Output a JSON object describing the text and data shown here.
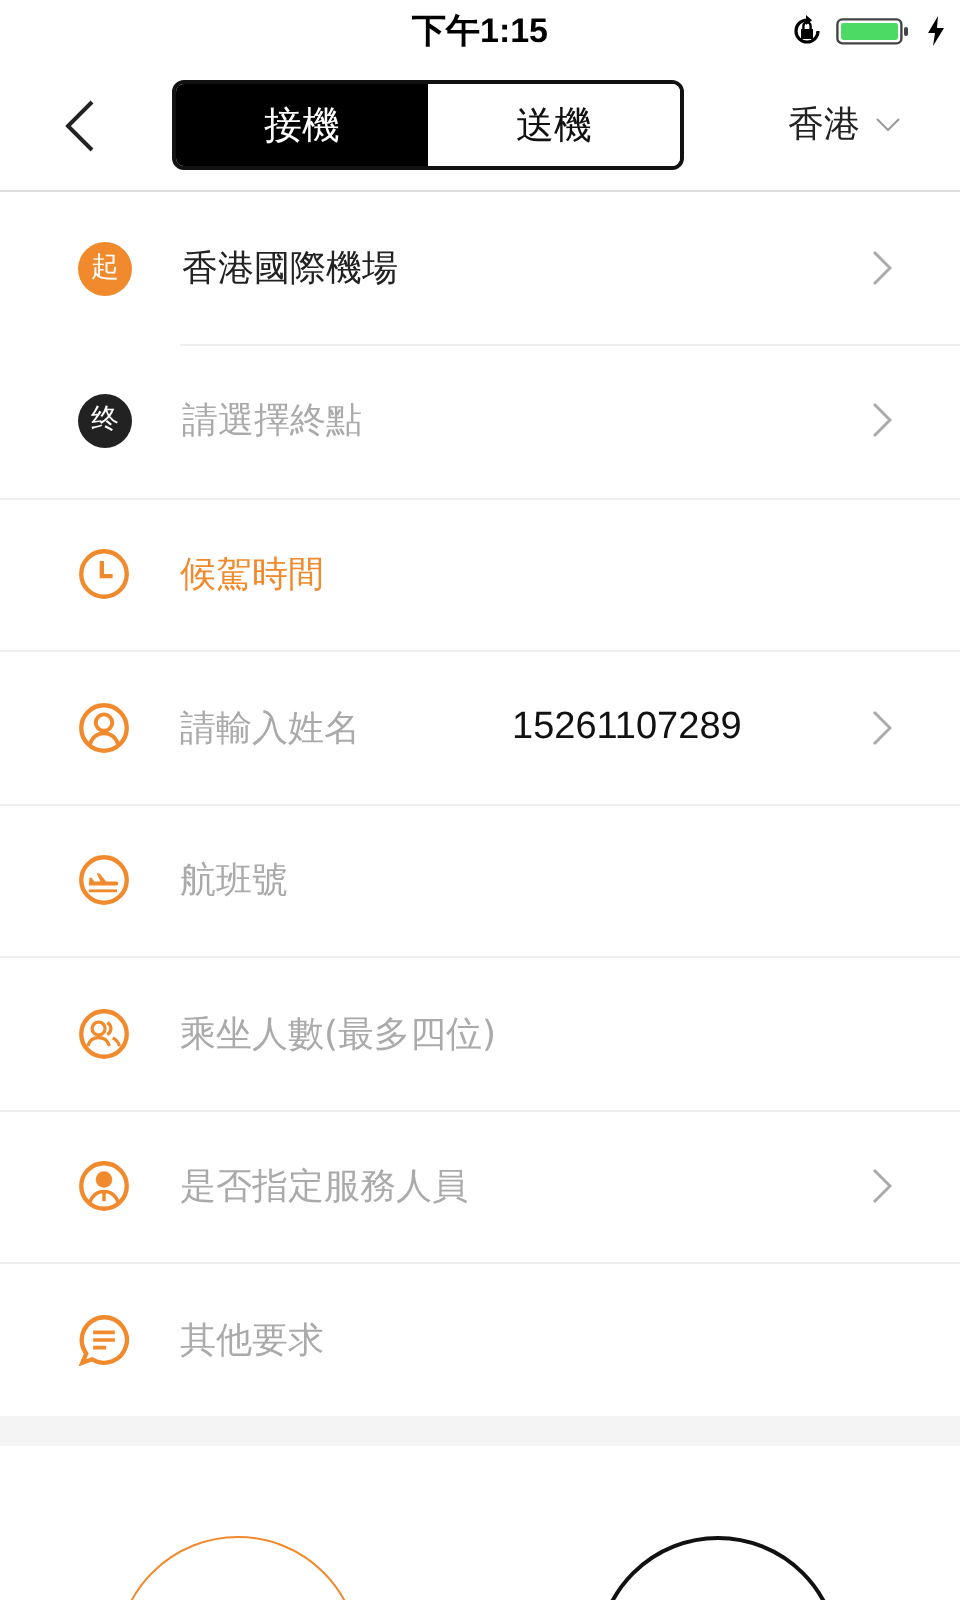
{
  "status_bar": {
    "time": "下午1:15"
  },
  "nav": {
    "tabs": [
      {
        "label": "接機",
        "selected": true
      },
      {
        "label": "送機",
        "selected": false
      }
    ],
    "region": "香港"
  },
  "rows": [
    {
      "kind": "start",
      "badge": "起",
      "color": "#f08a2c",
      "text": "香港國際機場",
      "hint": false,
      "arrow": true
    },
    {
      "kind": "end",
      "badge": "终",
      "color": "#222222",
      "text": "請選擇終點",
      "hint": true,
      "arrow": true
    },
    {
      "kind": "time",
      "text": "候駕時間",
      "arrow": false
    },
    {
      "kind": "name",
      "text": "請輸入姓名",
      "hint": true,
      "value": "15261107289",
      "arrow": true
    },
    {
      "kind": "flight",
      "text": "航班號",
      "hint": true,
      "arrow": false
    },
    {
      "kind": "passengers",
      "text": "乘坐人數(最多四位)",
      "hint": true,
      "arrow": false
    },
    {
      "kind": "staff",
      "text": "是否指定服務人員",
      "hint": true,
      "arrow": true
    },
    {
      "kind": "notes",
      "text": "其他要求",
      "hint": true,
      "arrow": false
    }
  ]
}
